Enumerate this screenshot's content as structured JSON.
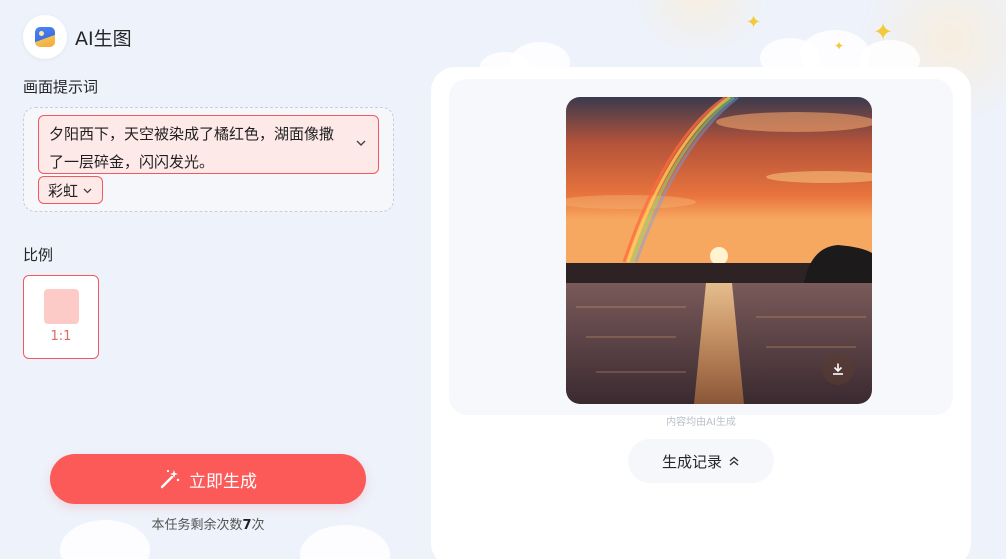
{
  "app": {
    "title": "AI生图",
    "logo_icon": "image-icon"
  },
  "prompt_section": {
    "label": "画面提示词",
    "text": "夕阳西下，天空被染成了橘红色，湖面像撒了一层碎金，闪闪发光。",
    "tag": "彩虹"
  },
  "ratio_section": {
    "label": "比例",
    "options": [
      {
        "label": "1:1",
        "selected": true
      }
    ]
  },
  "generate": {
    "button_label": "立即生成",
    "remaining_prefix": "本任务剩余次数",
    "remaining_count": "7",
    "remaining_suffix": "次"
  },
  "result": {
    "ai_note": "内容均由AI生成",
    "history_label": "生成记录",
    "download_icon": "download-icon"
  },
  "colors": {
    "accent": "#fb5a58",
    "accent_border": "#f2595e",
    "accent_bg": "#fde9e8",
    "page_bg": "#edf2fb"
  }
}
